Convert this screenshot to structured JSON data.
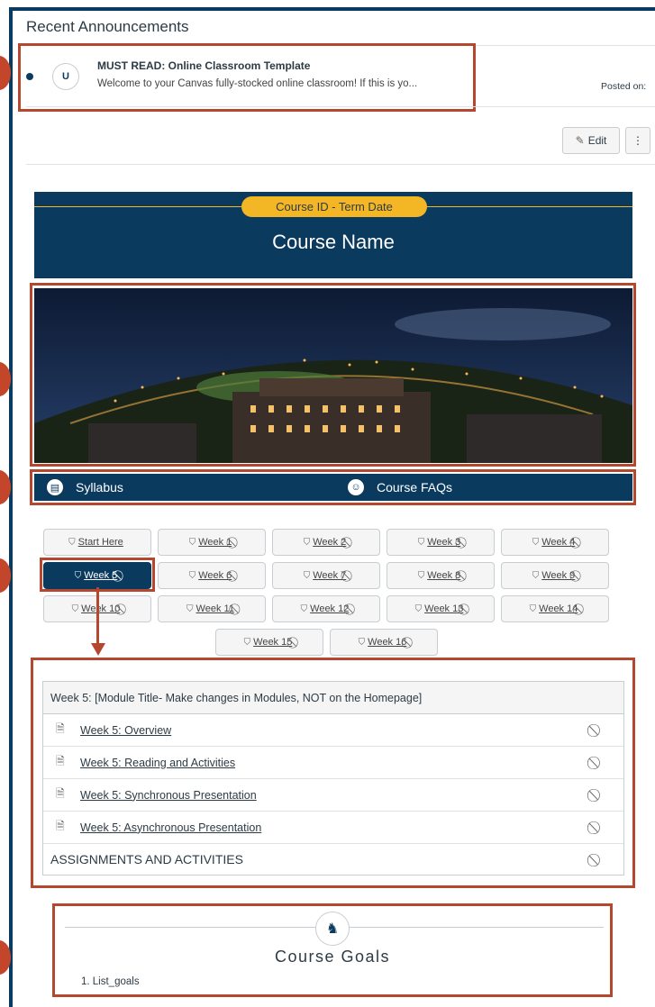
{
  "announcements": {
    "section_title": "Recent Announcements",
    "item": {
      "avatar_initial": "U",
      "title": "MUST READ: Online Classroom Template",
      "message": "Welcome to your Canvas fully-stocked online classroom! If this is yo...",
      "posted_label": "Posted on:"
    }
  },
  "toolbar": {
    "edit_label": "Edit",
    "edit_icon": "pencil-icon",
    "more_icon": "kebab-menu-icon"
  },
  "banner": {
    "course_id": "Course ID - Term Date",
    "course_name": "Course Name",
    "accent_color": "#f3b625",
    "brand_color": "#0b3a5f"
  },
  "nav": {
    "syllabus": "Syllabus",
    "faqs": "Course FAQs"
  },
  "weeks": {
    "start": "Start Here",
    "w1": "Week 1",
    "w2": "Week 2",
    "w3": "Week 3",
    "w4": "Week 4",
    "w5": "Week 5",
    "w6": "Week 6",
    "w7": "Week 7",
    "w8": "Week 8",
    "w9": "Week 9",
    "w10": "Week 10",
    "w11": "Week 11",
    "w12": "Week 12",
    "w13": "Week 13",
    "w14": "Week 14",
    "w15": "Week 15",
    "w16": "Week 16",
    "active": "Week 5"
  },
  "module": {
    "header": "Week 5: [Module Title- Make changes in Modules, NOT on the Homepage]",
    "items": [
      "Week 5: Overview",
      "Week 5: Reading and Activities",
      "Week 5: Synchronous Presentation",
      "Week 5: Asynchronous Presentation"
    ],
    "section": "ASSIGNMENTS AND ACTIVITIES"
  },
  "goals": {
    "title": "Course Goals",
    "item": "1. List_goals",
    "icon": "chess-knight-icon"
  },
  "annotation_color": "#b5472f"
}
